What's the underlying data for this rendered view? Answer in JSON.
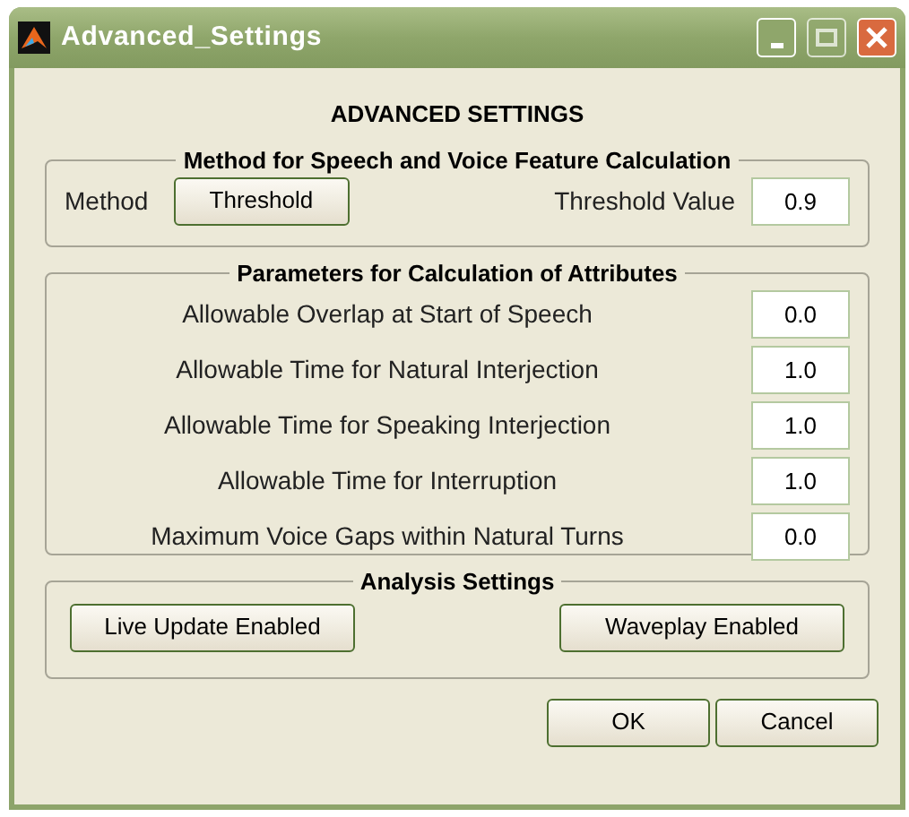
{
  "window": {
    "title": "Advanced_Settings"
  },
  "heading": "ADVANCED SETTINGS",
  "method_group": {
    "title": "Method for Speech and Voice Feature Calculation",
    "method_label": "Method",
    "method_button": "Threshold",
    "value_label": "Threshold Value",
    "value": "0.9"
  },
  "parameters_group": {
    "title": "Parameters for Calculation of Attributes",
    "rows": [
      {
        "label": "Allowable Overlap at Start of Speech",
        "value": "0.0"
      },
      {
        "label": "Allowable Time for Natural Interjection",
        "value": "1.0"
      },
      {
        "label": "Allowable Time for Speaking Interjection",
        "value": "1.0"
      },
      {
        "label": "Allowable Time for Interruption",
        "value": "1.0"
      },
      {
        "label": "Maximum Voice Gaps within Natural Turns",
        "value": "0.0"
      }
    ]
  },
  "analysis_group": {
    "title": "Analysis Settings",
    "buttons": [
      "Live Update Enabled",
      "Waveplay Enabled"
    ]
  },
  "buttons": [
    "OK",
    "Cancel"
  ]
}
